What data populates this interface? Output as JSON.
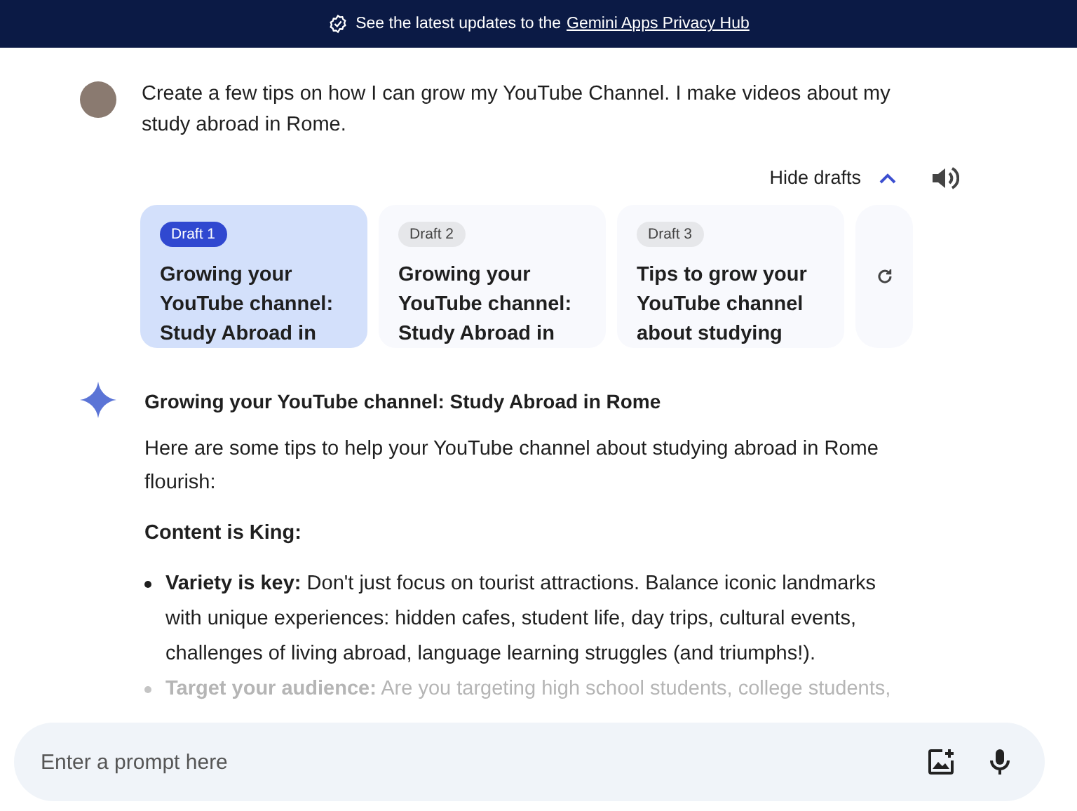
{
  "banner": {
    "text": "See the latest updates to the",
    "link": "Gemini Apps Privacy Hub"
  },
  "prompt": {
    "text": "Create a few tips on how I can grow my YouTube Channel. I make videos about my study abroad in Rome."
  },
  "drafts_toggle": {
    "label": "Hide drafts",
    "expanded": true
  },
  "drafts": [
    {
      "badge": "Draft 1",
      "title": "Growing your YouTube channel: Study Abroad in",
      "selected": true
    },
    {
      "badge": "Draft 2",
      "title": "Growing your YouTube channel: Study Abroad in",
      "selected": false
    },
    {
      "badge": "Draft 3",
      "title": "Tips to grow your YouTube channel about studying",
      "selected": false
    }
  ],
  "response": {
    "title": "Growing your YouTube channel: Study Abroad in Rome",
    "intro": "Here are some tips to help your YouTube channel about studying abroad in Rome flourish:",
    "heading": "Content is King:",
    "bullets": [
      {
        "text": "**Variety is key:** Don't just focus on tourist attractions. Balance iconic landmarks with unique experiences: hidden cafes, student life, day trips, cultural events, challenges of living abroad, language learning struggles (and triumphs!).",
        "faded": false
      },
      {
        "text": "**Target your audience:** Are you targeting high school students, college students,",
        "faded": true
      }
    ]
  },
  "input": {
    "placeholder": "Enter a prompt here"
  }
}
